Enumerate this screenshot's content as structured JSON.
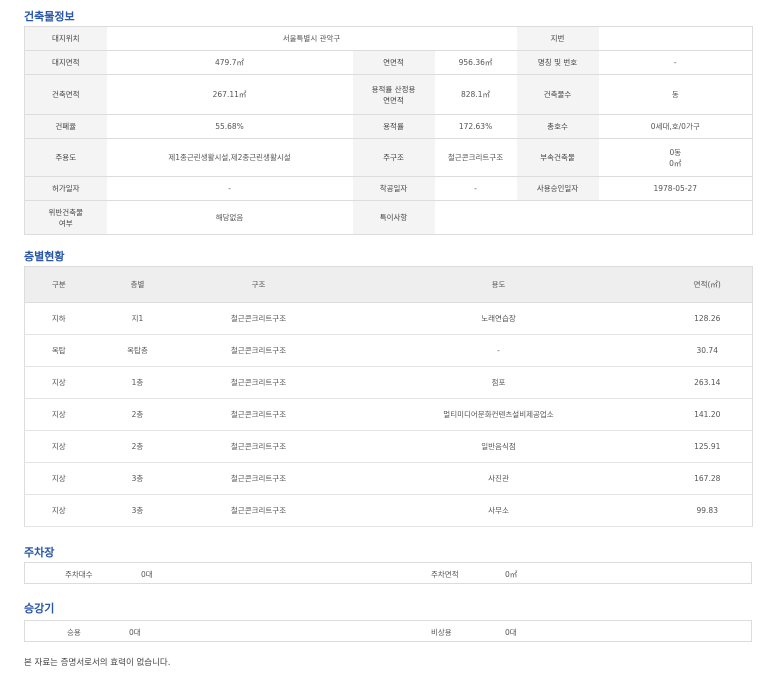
{
  "sections": {
    "building_info": "건축물정보",
    "floor_status": "층별현황",
    "parking": "주차장",
    "elevator": "승강기"
  },
  "building": {
    "site_location_label": "대지위치",
    "site_location": "서울특별시 관악구",
    "lot_number_label": "지번",
    "lot_number": "",
    "site_area_label": "대지면적",
    "site_area": "479.7㎡",
    "total_floor_area_label": "연면적",
    "total_floor_area": "956.36㎡",
    "name_number_label": "명칭 및 번호",
    "name_number": "-",
    "building_area_label": "건축면적",
    "building_area": "267.11㎡",
    "far_area_label_1": "용적률 산정용",
    "far_area_label_2": "연면적",
    "far_area": "828.1㎡",
    "building_count_label": "건축물수",
    "building_count": "동",
    "coverage_label": "건폐율",
    "coverage": "55.68%",
    "far_label": "용적률",
    "far": "172.63%",
    "units_label": "총호수",
    "units": "0세대,호/0가구",
    "main_use_label": "주용도",
    "main_use": "제1종근린생활시설,제2종근린생활시설",
    "structure_label": "주구조",
    "structure": "철근콘크리트구조",
    "annex_label": "부속건축물",
    "annex_1": "0동",
    "annex_2": "0㎡",
    "permit_date_label": "허가일자",
    "permit_date": "-",
    "start_date_label": "착공일자",
    "start_date": "-",
    "approval_date_label": "사용승인일자",
    "approval_date": "1978-05-27",
    "violation_label_1": "위반건축물",
    "violation_label_2": "여부",
    "violation": "해당없음",
    "remarks_label": "특이사항",
    "remarks": ""
  },
  "floors": {
    "headers": [
      "구분",
      "층별",
      "구조",
      "용도",
      "면적(㎡)"
    ],
    "rows": [
      [
        "지하",
        "지1",
        "철근콘크리트구조",
        "노래연습장",
        "128.26"
      ],
      [
        "옥탑",
        "옥탑층",
        "철근콘크리트구조",
        "-",
        "30.74"
      ],
      [
        "지상",
        "1층",
        "철근콘크리트구조",
        "점포",
        "263.14"
      ],
      [
        "지상",
        "2층",
        "철근콘크리트구조",
        "멀티미디어문화컨텐츠설비제공업소",
        "141.20"
      ],
      [
        "지상",
        "2층",
        "철근콘크리트구조",
        "일반음식점",
        "125.91"
      ],
      [
        "지상",
        "3층",
        "철근콘크리트구조",
        "사진관",
        "167.28"
      ],
      [
        "지상",
        "3층",
        "철근콘크리트구조",
        "사무소",
        "99.83"
      ]
    ]
  },
  "parking": {
    "count_label": "주차대수",
    "count": "0대",
    "area_label": "주차면적",
    "area": "0㎡"
  },
  "elevator": {
    "passenger_label": "승용",
    "passenger": "0대",
    "emergency_label": "비상용",
    "emergency": "0대"
  },
  "footer_note": "본 자료는 증명서로서의 효력이 없습니다."
}
